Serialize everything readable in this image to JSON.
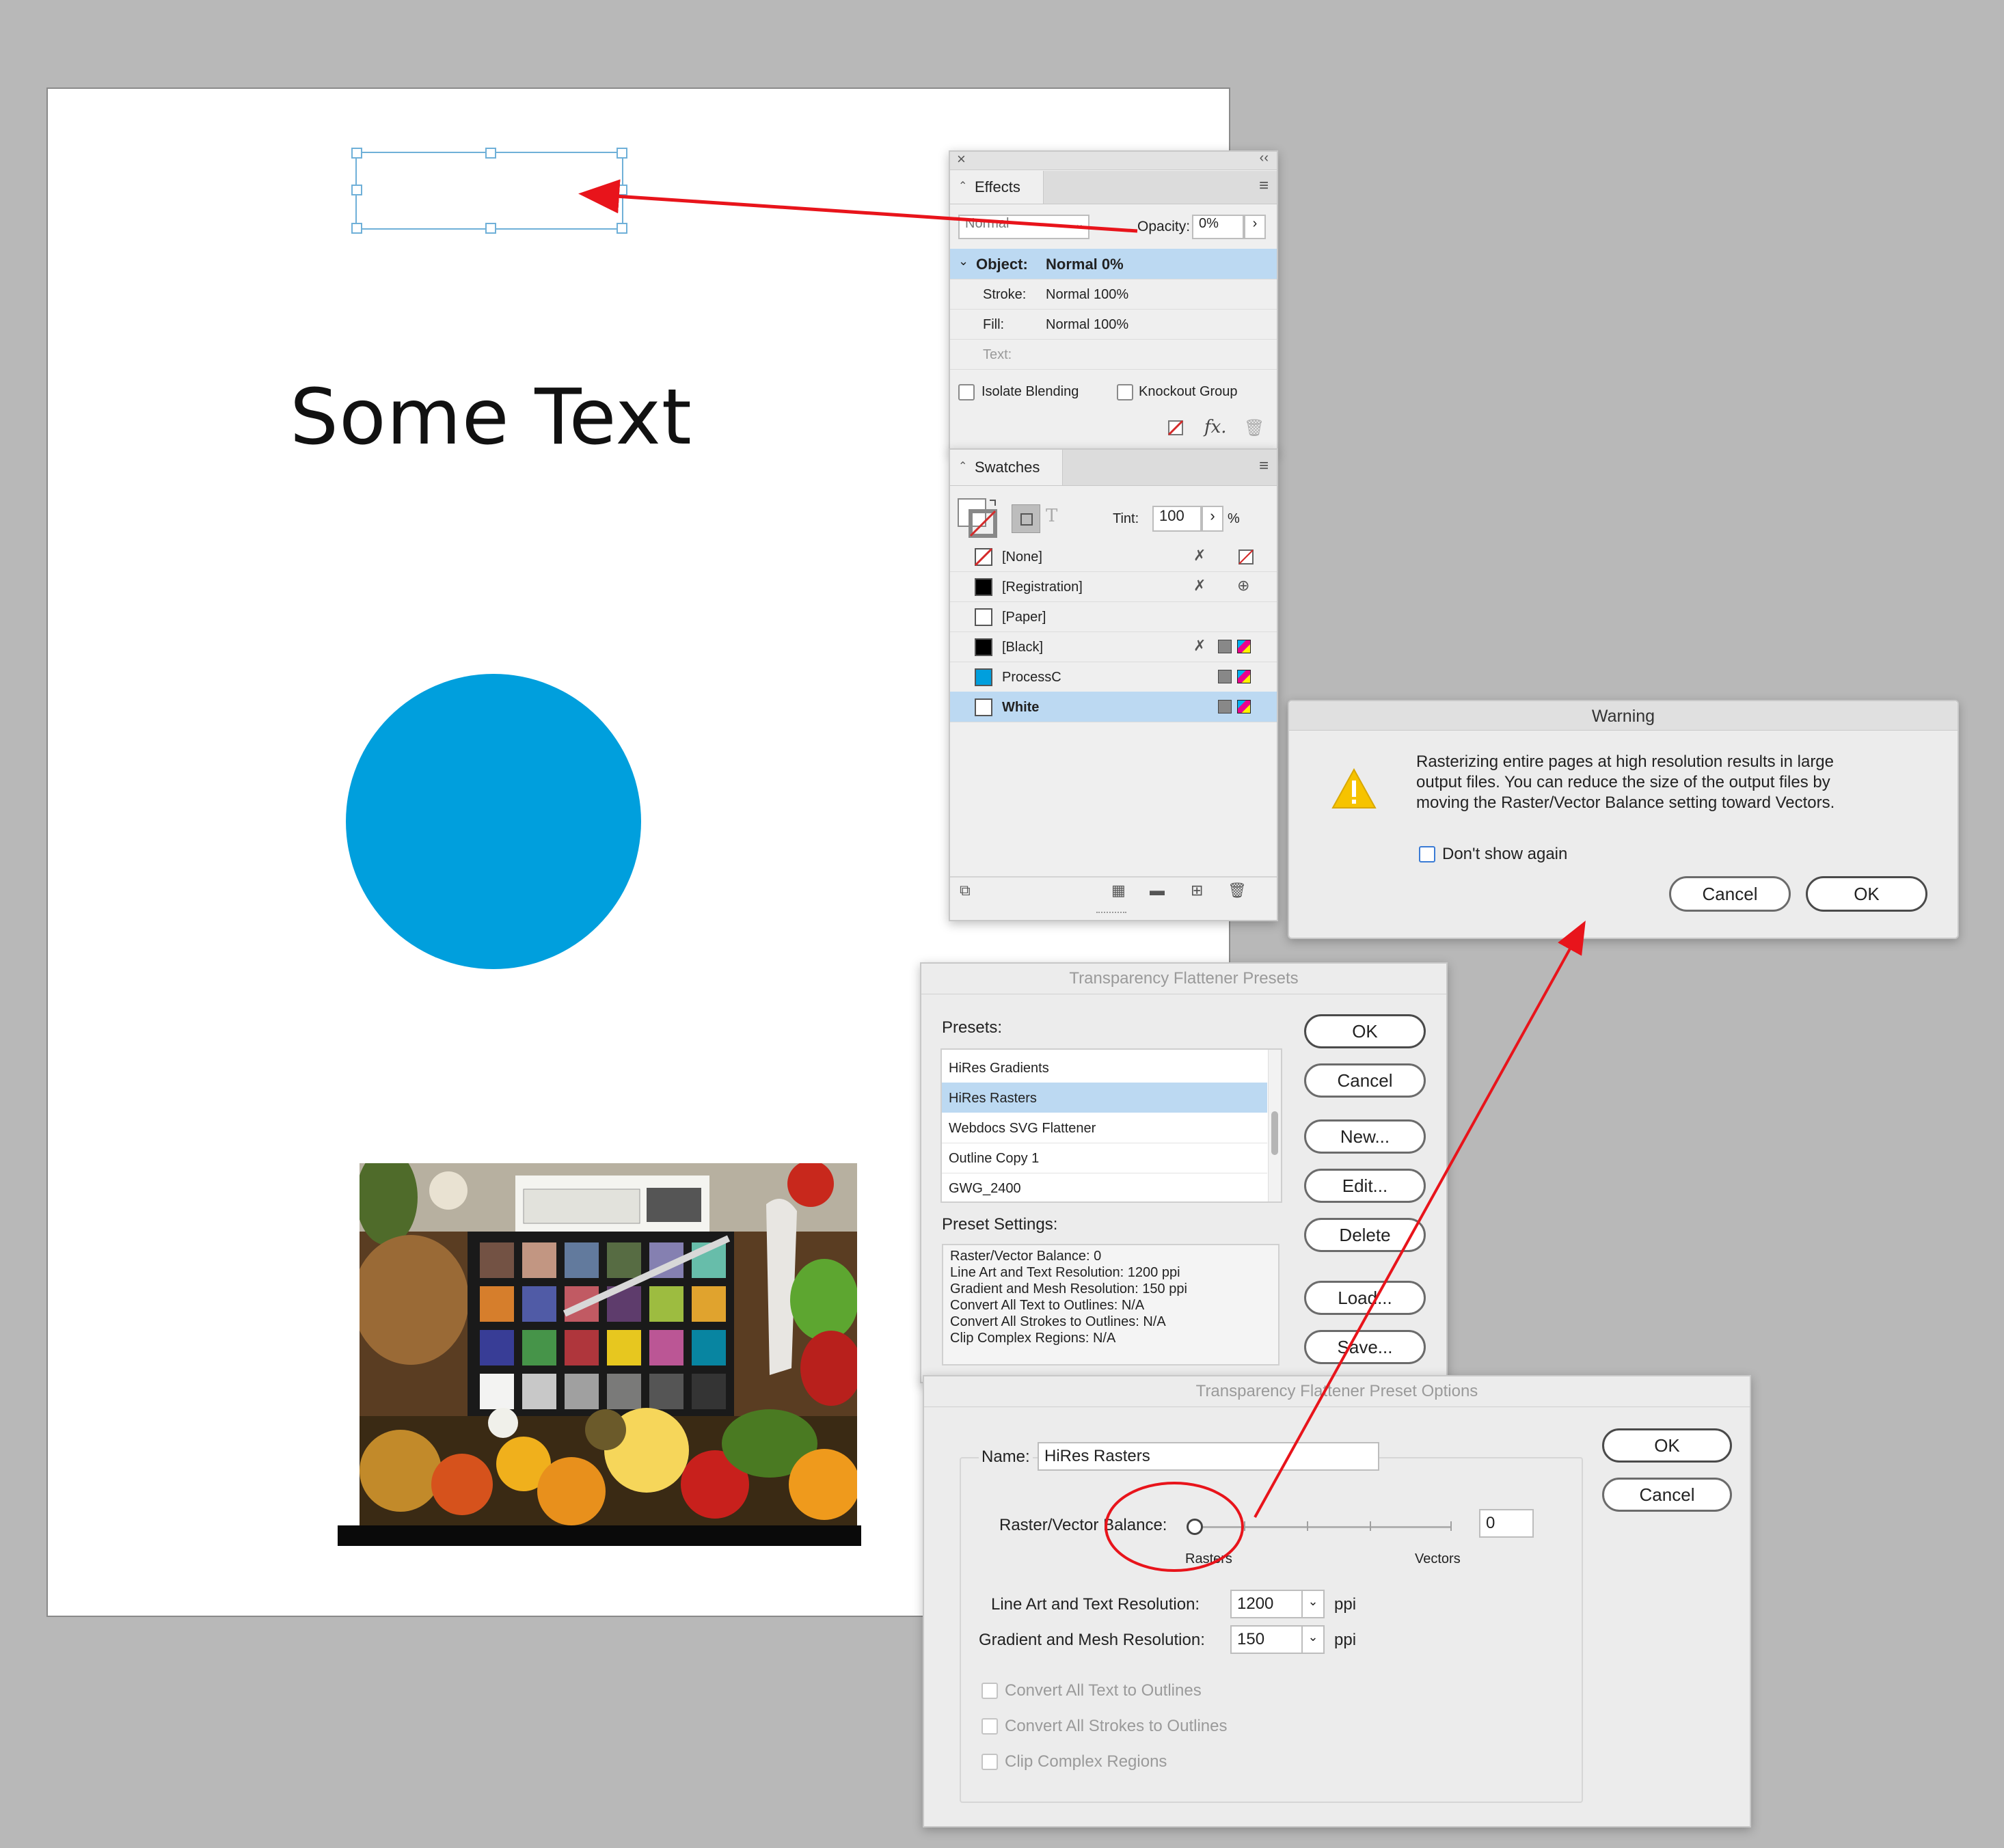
{
  "document": {
    "some_text": "Some Text",
    "circle_color": "#009fdd"
  },
  "effects_panel": {
    "tab_label": "Effects",
    "blend_mode": "Normal",
    "opacity_label": "Opacity:",
    "opacity_value": "0%",
    "rows": [
      {
        "label": "Object:",
        "value": "Normal 0%"
      },
      {
        "label": "Stroke:",
        "value": "Normal 100%"
      },
      {
        "label": "Fill:",
        "value": "Normal 100%"
      },
      {
        "label": "Text:",
        "value": ""
      }
    ],
    "isolate_blending": "Isolate Blending",
    "knockout_group": "Knockout Group",
    "fx_label": "fx."
  },
  "swatches_panel": {
    "tab_label": "Swatches",
    "tint_label": "Tint:",
    "tint_value": "100",
    "percent": "%",
    "swatches": [
      {
        "name": "[None]",
        "color": "none"
      },
      {
        "name": "[Registration]",
        "color": "#000000"
      },
      {
        "name": "[Paper]",
        "color": "#ffffff"
      },
      {
        "name": "[Black]",
        "color": "#000000"
      },
      {
        "name": "ProcessC",
        "color": "#009fdd"
      },
      {
        "name": "White",
        "color": "#ffffff"
      }
    ]
  },
  "warning_dialog": {
    "title": "Warning",
    "message_1": "Rasterizing entire pages at high resolution results in large",
    "message_2": "output files. You can reduce the size of the output files by",
    "message_3": "moving the Raster/Vector Balance setting toward Vectors.",
    "dont_show": "Don't show again",
    "cancel": "Cancel",
    "ok": "OK"
  },
  "presets_dialog": {
    "title": "Transparency Flattener Presets",
    "presets_label": "Presets:",
    "presets": [
      "HiRes Gradients",
      "HiRes Rasters",
      "Webdocs SVG Flattener",
      "Outline Copy 1",
      "GWG_2400"
    ],
    "settings_label": "Preset Settings:",
    "settings": [
      "Raster/Vector Balance: 0",
      "Line Art and Text Resolution: 1200 ppi",
      "Gradient and Mesh Resolution: 150 ppi",
      "Convert All Text to Outlines: N/A",
      "Convert All Strokes to Outlines: N/A",
      "Clip Complex Regions: N/A"
    ],
    "buttons": {
      "ok": "OK",
      "cancel": "Cancel",
      "new": "New...",
      "edit": "Edit...",
      "delete": "Delete",
      "load": "Load...",
      "save": "Save..."
    }
  },
  "options_dialog": {
    "title": "Transparency Flattener Preset Options",
    "name_label": "Name:",
    "name_value": "HiRes Rasters",
    "balance_label": "Raster/Vector Balance:",
    "balance_value": "0",
    "rasters": "Rasters",
    "vectors": "Vectors",
    "line_art_label": "Line Art and Text Resolution:",
    "line_art_value": "1200",
    "gradient_label": "Gradient and Mesh Resolution:",
    "gradient_value": "150",
    "ppi": "ppi",
    "convert_text": "Convert All Text to Outlines",
    "convert_strokes": "Convert All Strokes to Outlines",
    "clip_complex": "Clip Complex Regions",
    "ok": "OK",
    "cancel": "Cancel"
  },
  "colors": {
    "annotation": "#e8141b",
    "selection": "#bcd9f2"
  }
}
